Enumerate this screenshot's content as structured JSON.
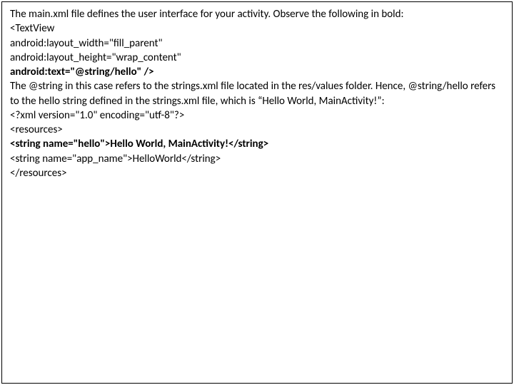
{
  "lines": [
    {
      "text": "The main.xml file defines the user interface for your activity. Observe the following in bold:",
      "bold": false
    },
    {
      "text": "<TextView",
      "bold": false
    },
    {
      "text": "android:layout_width=\"fill_parent\"",
      "bold": false
    },
    {
      "text": "android:layout_height=\"wrap_content\"",
      "bold": false
    },
    {
      "text": "android:text=\"@string/hello\" />",
      "bold": true
    },
    {
      "text": "The @string in this case refers to the strings.xml file located in the res/values folder. Hence, @string/hello refers to the hello string defined in the strings.xml file, which is “Hello World, MainActivity!”:",
      "bold": false
    },
    {
      "text": "<?xml version=\"1.0\" encoding=\"utf-8\"?>",
      "bold": false
    },
    {
      "text": "<resources>",
      "bold": false
    },
    {
      "text": "<string name=\"hello\">Hello World, MainActivity!</string>",
      "bold": true
    },
    {
      "text": "<string name=\"app_name\">HelloWorld</string>",
      "bold": false
    },
    {
      "text": "</resources>",
      "bold": false
    }
  ]
}
